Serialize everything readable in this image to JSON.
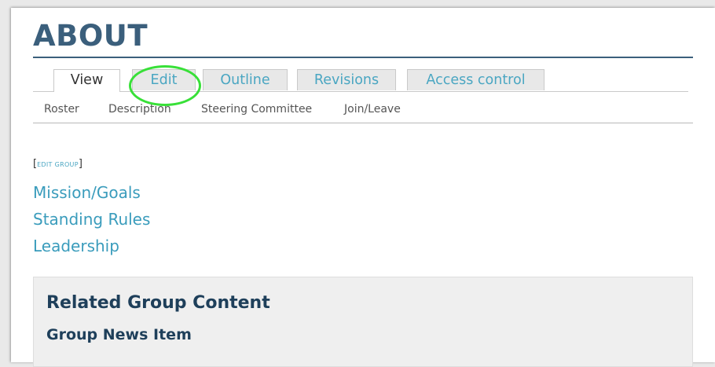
{
  "page": {
    "title": "ABOUT"
  },
  "tabs": [
    {
      "label": "View",
      "active": true
    },
    {
      "label": "Edit",
      "active": false,
      "highlighted": true
    },
    {
      "label": "Outline",
      "active": false
    },
    {
      "label": "Revisions",
      "active": false
    },
    {
      "label": "Access control",
      "active": false
    }
  ],
  "subtabs": [
    "Roster",
    "Description",
    "Steering Committee",
    "Join/Leave"
  ],
  "edit_group": {
    "open_bracket": "[",
    "link": "Edit Group",
    "close_bracket": "]"
  },
  "links": [
    "Mission/Goals",
    "Standing Rules",
    "Leadership"
  ],
  "related": {
    "heading": "Related Group Content",
    "subheading": "Group News Item"
  },
  "colors": {
    "title": "#3b5f7c",
    "link": "#3a9cbc",
    "highlight": "#38e038",
    "related_heading": "#1e3f5a"
  }
}
